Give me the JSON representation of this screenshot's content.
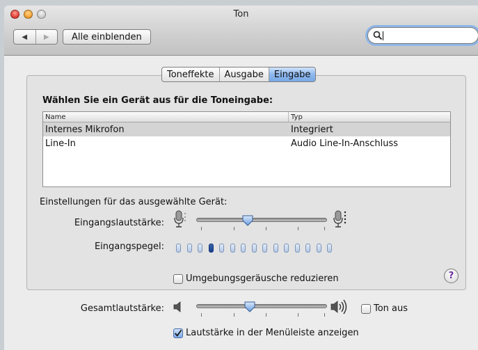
{
  "window": {
    "title": "Ton"
  },
  "toolbar": {
    "back_label": "◀",
    "forward_label": "▶",
    "show_all_label": "Alle einblenden",
    "search_value": ""
  },
  "tabs": [
    {
      "label": "Toneffekte",
      "active": false
    },
    {
      "label": "Ausgabe",
      "active": false
    },
    {
      "label": "Eingabe",
      "active": true
    }
  ],
  "input_panel": {
    "heading": "Wählen Sie ein Gerät aus für die Toneingabe:",
    "table": {
      "columns": [
        "Name",
        "Typ"
      ],
      "rows": [
        {
          "name": "Internes Mikrofon",
          "type": "Integriert",
          "selected": true
        },
        {
          "name": "Line-In",
          "type": "Audio Line-In-Anschluss",
          "selected": false
        }
      ]
    },
    "settings_heading": "Einstellungen für das ausgewählte Gerät:",
    "input_volume": {
      "label": "Eingangslautstärke:",
      "value": 0.38
    },
    "input_level": {
      "label": "Eingangspegel:",
      "total_segments": 15,
      "lit_segment": 4
    },
    "noise_reduction": {
      "label": "Umgebungsgeräusche reduzieren",
      "checked": false
    },
    "help_label": "?"
  },
  "output": {
    "volume": {
      "label": "Gesamtlautstärke:",
      "value": 0.4
    },
    "mute": {
      "label": "Ton aus",
      "checked": false
    },
    "menubar": {
      "label": "Lautstärke in der Menüleiste anzeigen",
      "checked": true
    }
  }
}
